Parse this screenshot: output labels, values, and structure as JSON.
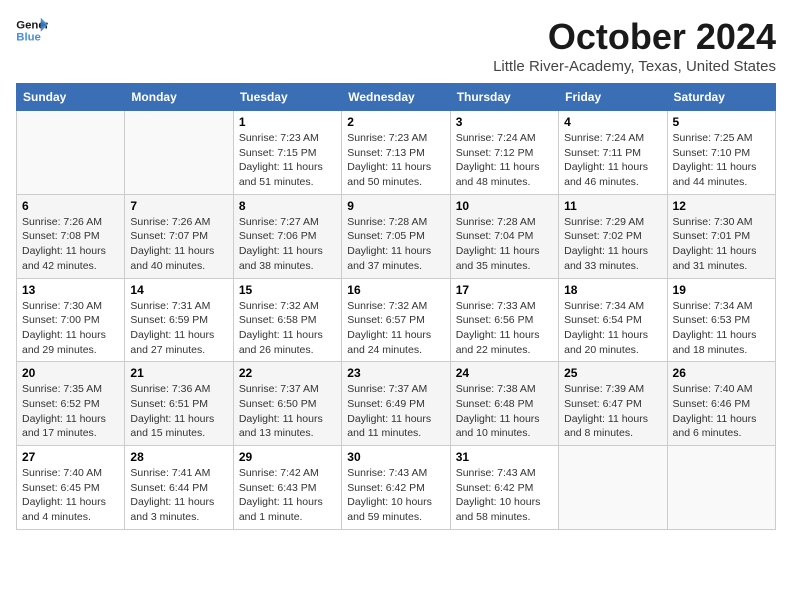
{
  "logo": {
    "line1": "General",
    "line2": "Blue"
  },
  "title": "October 2024",
  "location": "Little River-Academy, Texas, United States",
  "weekdays": [
    "Sunday",
    "Monday",
    "Tuesday",
    "Wednesday",
    "Thursday",
    "Friday",
    "Saturday"
  ],
  "weeks": [
    [
      {
        "day": "",
        "info": ""
      },
      {
        "day": "",
        "info": ""
      },
      {
        "day": "1",
        "info": "Sunrise: 7:23 AM\nSunset: 7:15 PM\nDaylight: 11 hours and 51 minutes."
      },
      {
        "day": "2",
        "info": "Sunrise: 7:23 AM\nSunset: 7:13 PM\nDaylight: 11 hours and 50 minutes."
      },
      {
        "day": "3",
        "info": "Sunrise: 7:24 AM\nSunset: 7:12 PM\nDaylight: 11 hours and 48 minutes."
      },
      {
        "day": "4",
        "info": "Sunrise: 7:24 AM\nSunset: 7:11 PM\nDaylight: 11 hours and 46 minutes."
      },
      {
        "day": "5",
        "info": "Sunrise: 7:25 AM\nSunset: 7:10 PM\nDaylight: 11 hours and 44 minutes."
      }
    ],
    [
      {
        "day": "6",
        "info": "Sunrise: 7:26 AM\nSunset: 7:08 PM\nDaylight: 11 hours and 42 minutes."
      },
      {
        "day": "7",
        "info": "Sunrise: 7:26 AM\nSunset: 7:07 PM\nDaylight: 11 hours and 40 minutes."
      },
      {
        "day": "8",
        "info": "Sunrise: 7:27 AM\nSunset: 7:06 PM\nDaylight: 11 hours and 38 minutes."
      },
      {
        "day": "9",
        "info": "Sunrise: 7:28 AM\nSunset: 7:05 PM\nDaylight: 11 hours and 37 minutes."
      },
      {
        "day": "10",
        "info": "Sunrise: 7:28 AM\nSunset: 7:04 PM\nDaylight: 11 hours and 35 minutes."
      },
      {
        "day": "11",
        "info": "Sunrise: 7:29 AM\nSunset: 7:02 PM\nDaylight: 11 hours and 33 minutes."
      },
      {
        "day": "12",
        "info": "Sunrise: 7:30 AM\nSunset: 7:01 PM\nDaylight: 11 hours and 31 minutes."
      }
    ],
    [
      {
        "day": "13",
        "info": "Sunrise: 7:30 AM\nSunset: 7:00 PM\nDaylight: 11 hours and 29 minutes."
      },
      {
        "day": "14",
        "info": "Sunrise: 7:31 AM\nSunset: 6:59 PM\nDaylight: 11 hours and 27 minutes."
      },
      {
        "day": "15",
        "info": "Sunrise: 7:32 AM\nSunset: 6:58 PM\nDaylight: 11 hours and 26 minutes."
      },
      {
        "day": "16",
        "info": "Sunrise: 7:32 AM\nSunset: 6:57 PM\nDaylight: 11 hours and 24 minutes."
      },
      {
        "day": "17",
        "info": "Sunrise: 7:33 AM\nSunset: 6:56 PM\nDaylight: 11 hours and 22 minutes."
      },
      {
        "day": "18",
        "info": "Sunrise: 7:34 AM\nSunset: 6:54 PM\nDaylight: 11 hours and 20 minutes."
      },
      {
        "day": "19",
        "info": "Sunrise: 7:34 AM\nSunset: 6:53 PM\nDaylight: 11 hours and 18 minutes."
      }
    ],
    [
      {
        "day": "20",
        "info": "Sunrise: 7:35 AM\nSunset: 6:52 PM\nDaylight: 11 hours and 17 minutes."
      },
      {
        "day": "21",
        "info": "Sunrise: 7:36 AM\nSunset: 6:51 PM\nDaylight: 11 hours and 15 minutes."
      },
      {
        "day": "22",
        "info": "Sunrise: 7:37 AM\nSunset: 6:50 PM\nDaylight: 11 hours and 13 minutes."
      },
      {
        "day": "23",
        "info": "Sunrise: 7:37 AM\nSunset: 6:49 PM\nDaylight: 11 hours and 11 minutes."
      },
      {
        "day": "24",
        "info": "Sunrise: 7:38 AM\nSunset: 6:48 PM\nDaylight: 11 hours and 10 minutes."
      },
      {
        "day": "25",
        "info": "Sunrise: 7:39 AM\nSunset: 6:47 PM\nDaylight: 11 hours and 8 minutes."
      },
      {
        "day": "26",
        "info": "Sunrise: 7:40 AM\nSunset: 6:46 PM\nDaylight: 11 hours and 6 minutes."
      }
    ],
    [
      {
        "day": "27",
        "info": "Sunrise: 7:40 AM\nSunset: 6:45 PM\nDaylight: 11 hours and 4 minutes."
      },
      {
        "day": "28",
        "info": "Sunrise: 7:41 AM\nSunset: 6:44 PM\nDaylight: 11 hours and 3 minutes."
      },
      {
        "day": "29",
        "info": "Sunrise: 7:42 AM\nSunset: 6:43 PM\nDaylight: 11 hours and 1 minute."
      },
      {
        "day": "30",
        "info": "Sunrise: 7:43 AM\nSunset: 6:42 PM\nDaylight: 10 hours and 59 minutes."
      },
      {
        "day": "31",
        "info": "Sunrise: 7:43 AM\nSunset: 6:42 PM\nDaylight: 10 hours and 58 minutes."
      },
      {
        "day": "",
        "info": ""
      },
      {
        "day": "",
        "info": ""
      }
    ]
  ]
}
